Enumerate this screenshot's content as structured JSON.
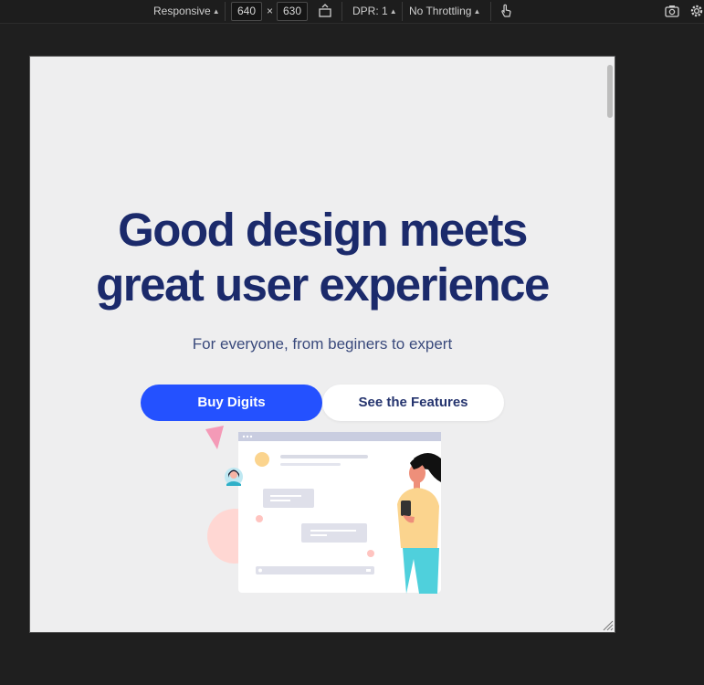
{
  "toolbar": {
    "device": "Responsive",
    "width": "640",
    "height": "630",
    "times": "×",
    "dpr": "DPR: 1",
    "throttling": "No Throttling"
  },
  "hero": {
    "title_line1": "Good design meets",
    "title_line2": "great user experience",
    "subtitle": "For everyone, from beginers to expert",
    "primary_button": "Buy Digits",
    "secondary_button": "See the Features"
  },
  "colors": {
    "title": "#1b2a6b",
    "primary": "#2451ff",
    "page_bg": "#eeeeef",
    "chrome_bg": "#1f1f1f"
  }
}
